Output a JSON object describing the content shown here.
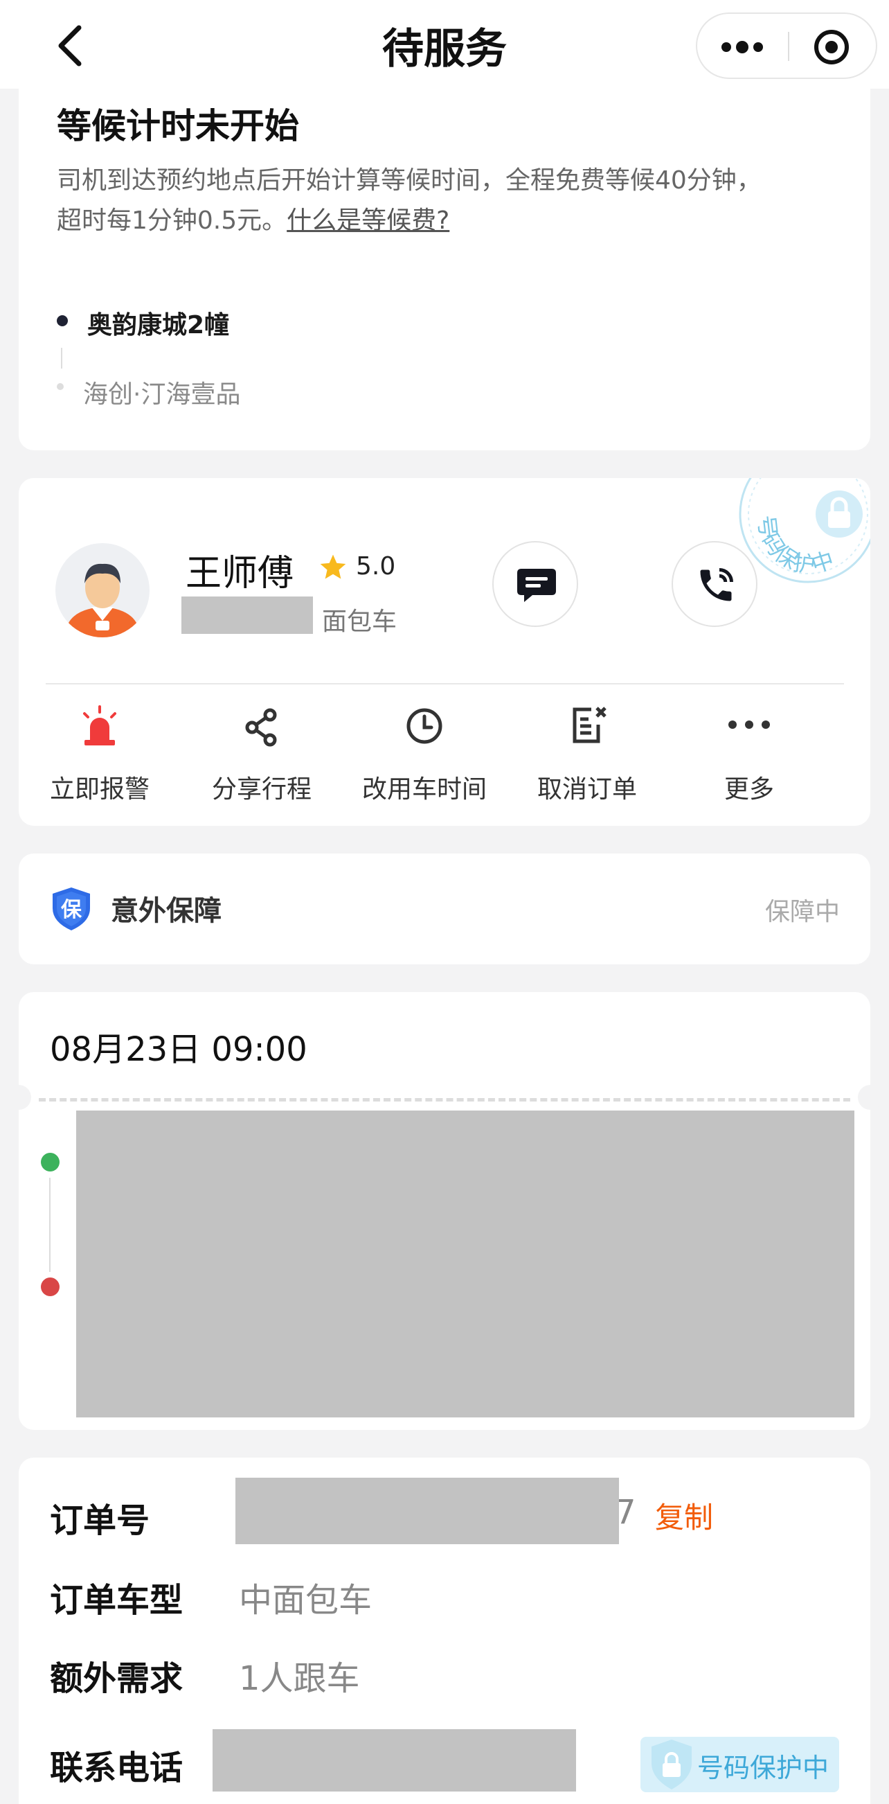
{
  "nav": {
    "title": "待服务",
    "more_icon": "ellipsis-icon",
    "close_icon": "target-circle-icon"
  },
  "waiting": {
    "title": "等候计时未开始",
    "desc_line1": "司机到达预约地点后开始计算等候时间，全程免费等候40分钟，",
    "desc_line2": "超时每1分钟0.5元。",
    "desc_link": "什么是等候费?"
  },
  "route": {
    "start": "奥韵康城2幢",
    "end": "海创·汀海壹品"
  },
  "driver": {
    "name": "王师傅",
    "rating": "5.0",
    "car_type": "面包车",
    "stamp_text": "号码保护中",
    "chat_icon": "chat-bubble-icon",
    "phone_icon": "phone-icon"
  },
  "actions": [
    {
      "label": "立即报警",
      "icon": "alarm-siren-icon"
    },
    {
      "label": "分享行程",
      "icon": "share-icon"
    },
    {
      "label": "改用车时间",
      "icon": "clock-icon"
    },
    {
      "label": "取消订单",
      "icon": "cancel-order-icon"
    },
    {
      "label": "更多",
      "icon": "more-dots-icon"
    }
  ],
  "insurance": {
    "badge": "保",
    "label": "意外保障",
    "status": "保障中"
  },
  "trip": {
    "time": "08月23日 09:00"
  },
  "order": {
    "id_label": "订单号",
    "id_suffix": "7",
    "copy_label": "复制",
    "type_label": "订单车型",
    "type_value": "中面包车",
    "extra_label": "额外需求",
    "extra_value": "1人跟车",
    "phone_label": "联系电话",
    "phone_badge": "号码保护中"
  },
  "colors": {
    "accent_orange": "#f25c0a",
    "alarm_red": "#f03b3b",
    "start_green": "#3cb25c",
    "end_red": "#d94646",
    "shield_blue": "#2e6be6",
    "protect_cyan": "#7ec9e6"
  }
}
